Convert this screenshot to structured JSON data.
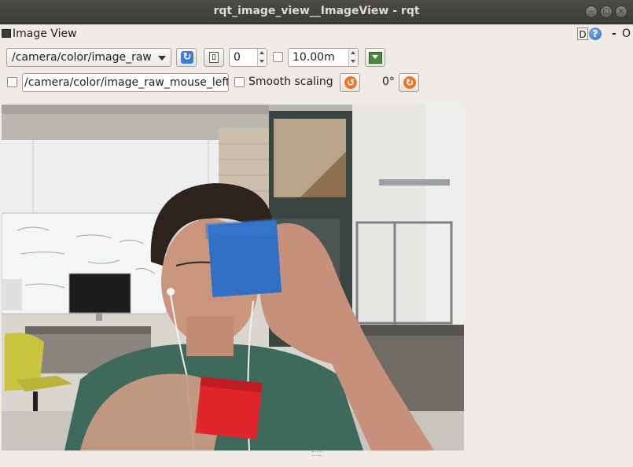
{
  "window": {
    "title": "rqt_image_view__ImageView - rqt"
  },
  "plugin": {
    "title": "Image View",
    "d_label": "D",
    "help_label": "?",
    "dash_label": "-",
    "close_label": "O"
  },
  "toolbar": {
    "topic": "/camera/color/image_raw",
    "refresh_icon": "refresh-icon",
    "save_icon": "save-icon",
    "num_gridlines": "0",
    "max_range": "10.00m",
    "fit_icon": "zoom-fit-icon"
  },
  "row2": {
    "mouse_topic": "/camera/color/image_raw_mouse_left",
    "smooth_label": "Smooth scaling",
    "rotation": "0°",
    "rotate_left_icon": "rotate-ccw-icon",
    "rotate_right_icon": "rotate-cw-icon"
  },
  "colors": {
    "titlebar": "#3c3b37",
    "background": "#efebe7",
    "accent_blue": "#3e7bd6",
    "accent_orange": "#e8792b"
  }
}
